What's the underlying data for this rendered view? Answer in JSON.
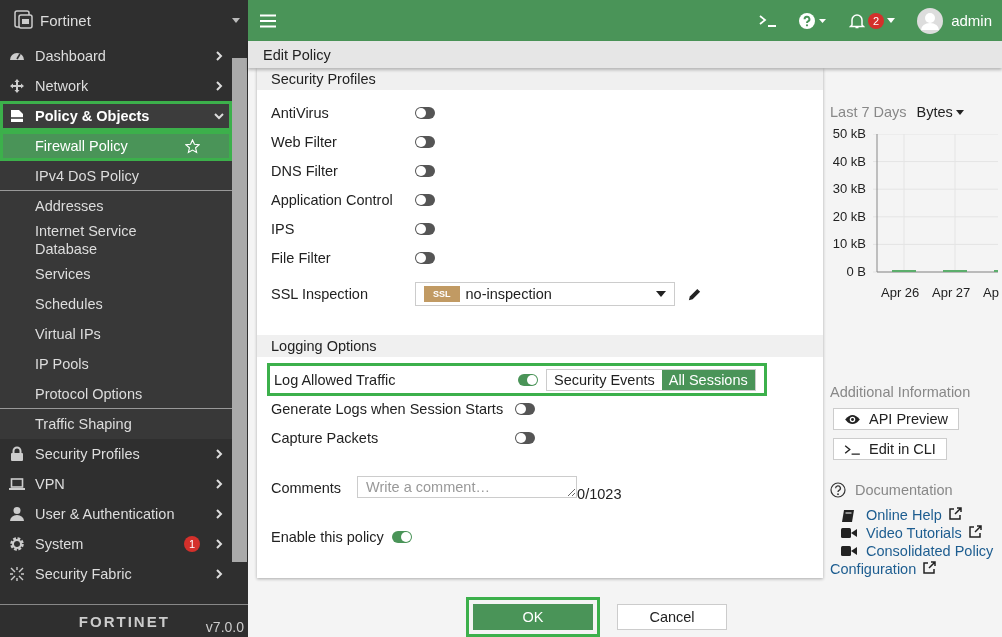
{
  "sidebar": {
    "title": "Fortinet",
    "items": [
      {
        "label": "Dashboard",
        "expanded": false,
        "highlighted": false
      },
      {
        "label": "Network",
        "expanded": false,
        "highlighted": false
      },
      {
        "label": "Policy & Objects",
        "expanded": true,
        "highlighted": true,
        "children": [
          {
            "label": "Firewall Policy",
            "selected": true,
            "highlighted": true,
            "divider_after": false
          },
          {
            "label": "IPv4 DoS Policy",
            "selected": false,
            "highlighted": false,
            "divider_after": true
          },
          {
            "label": "Addresses",
            "selected": false,
            "highlighted": false,
            "divider_after": false
          },
          {
            "label": "Internet Service Database",
            "selected": false,
            "highlighted": false,
            "divider_after": false
          },
          {
            "label": "Services",
            "selected": false,
            "highlighted": false,
            "divider_after": false
          },
          {
            "label": "Schedules",
            "selected": false,
            "highlighted": false,
            "divider_after": false
          },
          {
            "label": "Virtual IPs",
            "selected": false,
            "highlighted": false,
            "divider_after": false
          },
          {
            "label": "IP Pools",
            "selected": false,
            "highlighted": false,
            "divider_after": false
          },
          {
            "label": "Protocol Options",
            "selected": false,
            "highlighted": false,
            "divider_after": true
          },
          {
            "label": "Traffic Shaping",
            "selected": false,
            "highlighted": false,
            "divider_after": false
          }
        ]
      },
      {
        "label": "Security Profiles",
        "expanded": false,
        "highlighted": false
      },
      {
        "label": "VPN",
        "expanded": false,
        "highlighted": false
      },
      {
        "label": "User & Authentication",
        "expanded": false,
        "highlighted": false
      },
      {
        "label": "System",
        "expanded": false,
        "highlighted": false,
        "badge": "1"
      },
      {
        "label": "Security Fabric",
        "expanded": false,
        "highlighted": false
      }
    ],
    "logo": "FORTINET",
    "version": "v7.0.0"
  },
  "topbar": {
    "notifications": "2",
    "user": "admin"
  },
  "page_title": "Edit Policy",
  "form": {
    "sections": [
      {
        "title": "Security Profiles",
        "rows": [
          {
            "kind": "toggle",
            "label": "AntiVirus",
            "on": false
          },
          {
            "kind": "toggle",
            "label": "Web Filter",
            "on": false
          },
          {
            "kind": "toggle",
            "label": "DNS Filter",
            "on": false
          },
          {
            "kind": "toggle",
            "label": "Application Control",
            "on": false
          },
          {
            "kind": "toggle",
            "label": "IPS",
            "on": false
          },
          {
            "kind": "toggle",
            "label": "File Filter",
            "on": false
          },
          {
            "kind": "select",
            "label": "SSL Inspection",
            "tag": "SSL",
            "value": "no-inspection"
          }
        ]
      },
      {
        "title": "Logging Options",
        "rows": [
          {
            "kind": "toggle",
            "label": "Log Allowed Traffic",
            "on": true,
            "highlighted": true,
            "options": [
              {
                "label": "Security Events",
                "selected": false
              },
              {
                "label": "All Sessions",
                "selected": true
              }
            ]
          },
          {
            "kind": "toggle",
            "label": "Generate Logs when Session Starts",
            "on": false
          },
          {
            "kind": "toggle",
            "label": "Capture Packets",
            "on": false
          }
        ]
      }
    ],
    "comments": {
      "label": "Comments",
      "placeholder": "Write a comment…",
      "count": "0/1023"
    },
    "enable": {
      "label": "Enable this policy",
      "on": true
    }
  },
  "buttons": [
    {
      "label": "OK",
      "kind": "primary",
      "highlighted": true
    },
    {
      "label": "Cancel",
      "kind": "secondary",
      "highlighted": false
    }
  ],
  "side_panel": {
    "range": "Last 7 Days",
    "metric": "Bytes",
    "chart_data": {
      "type": "bar",
      "grid": true,
      "categories": [
        "Apr 26",
        "Apr 27",
        "Ap"
      ],
      "values": [
        0,
        0,
        0
      ],
      "ylim": [
        0,
        50
      ],
      "yticks": [
        {
          "value": 0,
          "label": "0 B"
        },
        {
          "value": 10,
          "label": "10 kB"
        },
        {
          "value": 20,
          "label": "20 kB"
        },
        {
          "value": 30,
          "label": "30 kB"
        },
        {
          "value": 40,
          "label": "40 kB"
        },
        {
          "value": 50,
          "label": "50 kB"
        }
      ]
    },
    "additional_info": {
      "title": "Additional Information",
      "buttons": [
        {
          "kind": "preview",
          "label": "API Preview"
        },
        {
          "kind": "cli",
          "label": "Edit in CLI"
        }
      ]
    },
    "documentation": {
      "title": "Documentation",
      "links": [
        {
          "kind": "help",
          "label": "Online Help"
        },
        {
          "kind": "video",
          "label": "Video Tutorials"
        },
        {
          "kind": "video",
          "label": "Consolidated Policy Configuration"
        }
      ]
    }
  }
}
